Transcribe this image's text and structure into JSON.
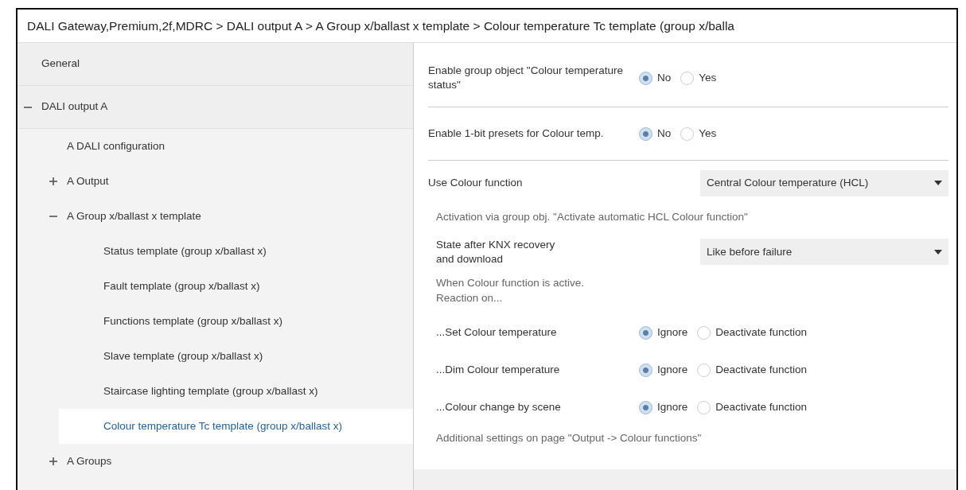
{
  "breadcrumb": "DALI Gateway,Premium,2f,MDRC > DALI output A > A Group x/ballast x template > Colour temperature Tc template (group x/balla",
  "sidebar": {
    "items": [
      {
        "label": "General",
        "selected": false
      },
      {
        "label": "DALI output A",
        "expanded": true,
        "selected": false,
        "children": [
          {
            "label": "A DALI configuration",
            "selected": false
          },
          {
            "label": "A Output",
            "expanded": false,
            "selected": false
          },
          {
            "label": "A Group x/ballast x template",
            "expanded": true,
            "selected": false,
            "children": [
              {
                "label": "Status template (group x/ballast x)",
                "selected": false
              },
              {
                "label": "Fault template (group x/ballast x)",
                "selected": false
              },
              {
                "label": "Functions template (group x/ballast x)",
                "selected": false
              },
              {
                "label": "Slave template (group x/ballast x)",
                "selected": false
              },
              {
                "label": "Staircase lighting template (group x/ballast x)",
                "selected": false
              },
              {
                "label": "Colour temperature Tc template (group x/ballast x)",
                "selected": true
              }
            ]
          },
          {
            "label": "A Groups",
            "expanded": false,
            "selected": false
          }
        ]
      }
    ]
  },
  "parameters": [
    {
      "kind": "radio",
      "label": "Enable group object \"Colour temperature status\"",
      "options": [
        {
          "label": "No",
          "selected": true
        },
        {
          "label": "Yes",
          "selected": false
        }
      ]
    },
    {
      "kind": "divider"
    },
    {
      "kind": "radio",
      "label": "Enable 1-bit presets for Colour temp.",
      "options": [
        {
          "label": "No",
          "selected": true
        },
        {
          "label": "Yes",
          "selected": false
        }
      ]
    },
    {
      "kind": "divider"
    },
    {
      "kind": "dropdown",
      "label": "Use Colour function",
      "value": "Central Colour temperature (HCL)"
    },
    {
      "kind": "note",
      "label": "Activation via group obj. \"Activate automatic HCL Colour function\""
    },
    {
      "kind": "dropdown",
      "label": "State after KNX recovery\nand download",
      "value": "Like before failure"
    },
    {
      "kind": "note",
      "label": "When Colour function is active.\nReaction on..."
    },
    {
      "kind": "radio",
      "label": "...Set Colour temperature",
      "options": [
        {
          "label": "Ignore",
          "selected": true
        },
        {
          "label": "Deactivate function",
          "selected": false
        }
      ]
    },
    {
      "kind": "radio",
      "label": "...Dim Colour temperature",
      "options": [
        {
          "label": "Ignore",
          "selected": true
        },
        {
          "label": "Deactivate function",
          "selected": false
        }
      ]
    },
    {
      "kind": "radio",
      "label": "...Colour change by scene",
      "options": [
        {
          "label": "Ignore",
          "selected": true
        },
        {
          "label": "Deactivate function",
          "selected": false
        }
      ]
    },
    {
      "kind": "note",
      "label": "Additional settings on page \"Output -> Colour functions\""
    }
  ]
}
